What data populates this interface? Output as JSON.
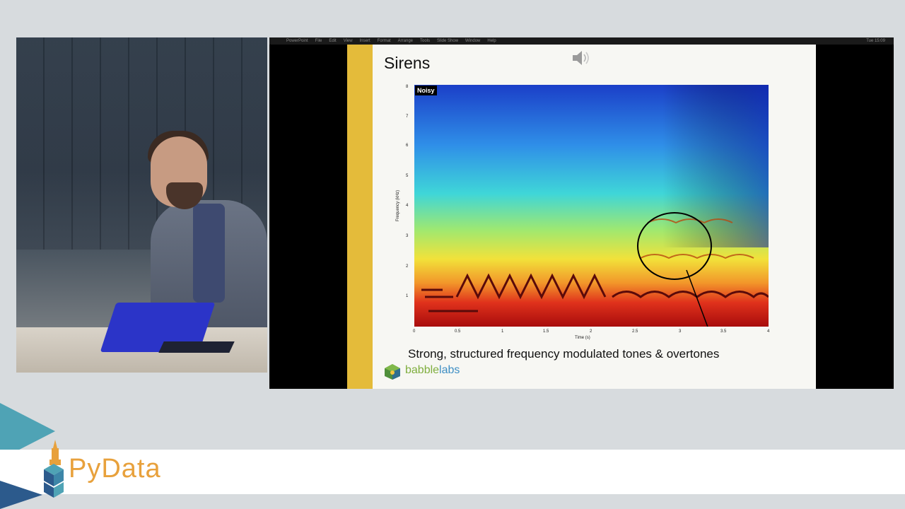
{
  "menubar": {
    "items": [
      "PowerPoint",
      "File",
      "Edit",
      "View",
      "Insert",
      "Format",
      "Arrange",
      "Tools",
      "Slide Show",
      "Window",
      "Help"
    ],
    "clock": "Tue 15:09"
  },
  "slide": {
    "title": "Sirens",
    "badge": "Noisy",
    "caption": "Strong, structured frequency modulated tones & overtones",
    "brand_left": "babble",
    "brand_right": "labs",
    "audio_icon": "speaker-icon"
  },
  "chart_data": {
    "type": "heatmap",
    "xlabel": "Time (s)",
    "ylabel": "Frequency (kHz)",
    "xlim": [
      0,
      4
    ],
    "ylim": [
      0,
      8
    ],
    "x_ticks": [
      "0",
      "0.5",
      "1",
      "1.5",
      "2",
      "2.5",
      "3",
      "3.5",
      "4"
    ],
    "y_ticks": [
      "1",
      "2",
      "3",
      "4",
      "5",
      "6",
      "7",
      "8"
    ],
    "colormap": "jet",
    "annotation": "circled overtones"
  },
  "banner": {
    "brand": "PyData",
    "colors": {
      "orange": "#e8a13c",
      "teal": "#4fa3b5",
      "navy": "#2c5a8c"
    }
  }
}
